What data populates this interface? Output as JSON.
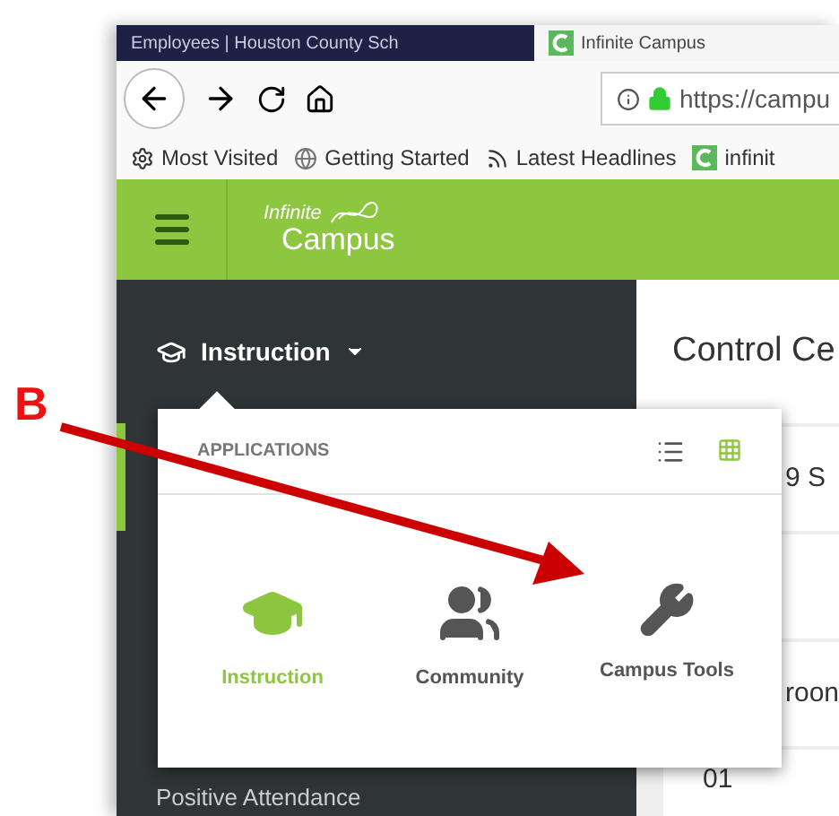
{
  "annotation": {
    "label": "B"
  },
  "browser": {
    "tabs": [
      {
        "title": "Employees | Houston County Sch",
        "selected": false
      },
      {
        "title": "Infinite Campus",
        "selected": true
      }
    ],
    "url": "https://campu",
    "bookmarks": [
      {
        "label": "Most Visited",
        "kind": "gear"
      },
      {
        "label": "Getting Started",
        "kind": "globe"
      },
      {
        "label": "Latest Headlines",
        "kind": "rss"
      },
      {
        "label": "infinit",
        "kind": "campus"
      }
    ]
  },
  "header": {
    "logo_top": "Infinite",
    "logo_bottom": "Campus"
  },
  "sidebar": {
    "menu": "Instruction",
    "items": [
      "Positive Attendance"
    ]
  },
  "content": {
    "title": "Control Ce",
    "rows": [
      {
        "text": "9 S",
        "covered": true
      },
      {
        "text": "",
        "covered": true
      },
      {
        "text": "roon",
        "covered": true
      },
      {
        "text": "01",
        "covered": false
      }
    ]
  },
  "popover": {
    "heading": "APPLICATIONS",
    "views": [
      {
        "kind": "list",
        "selected": false
      },
      {
        "kind": "grid",
        "selected": true
      }
    ],
    "apps": [
      {
        "label": "Instruction",
        "kind": "cap",
        "selected": true
      },
      {
        "label": "Community",
        "kind": "people",
        "selected": false
      },
      {
        "label": "Campus Tools",
        "kind": "wrench",
        "selected": false
      }
    ]
  }
}
